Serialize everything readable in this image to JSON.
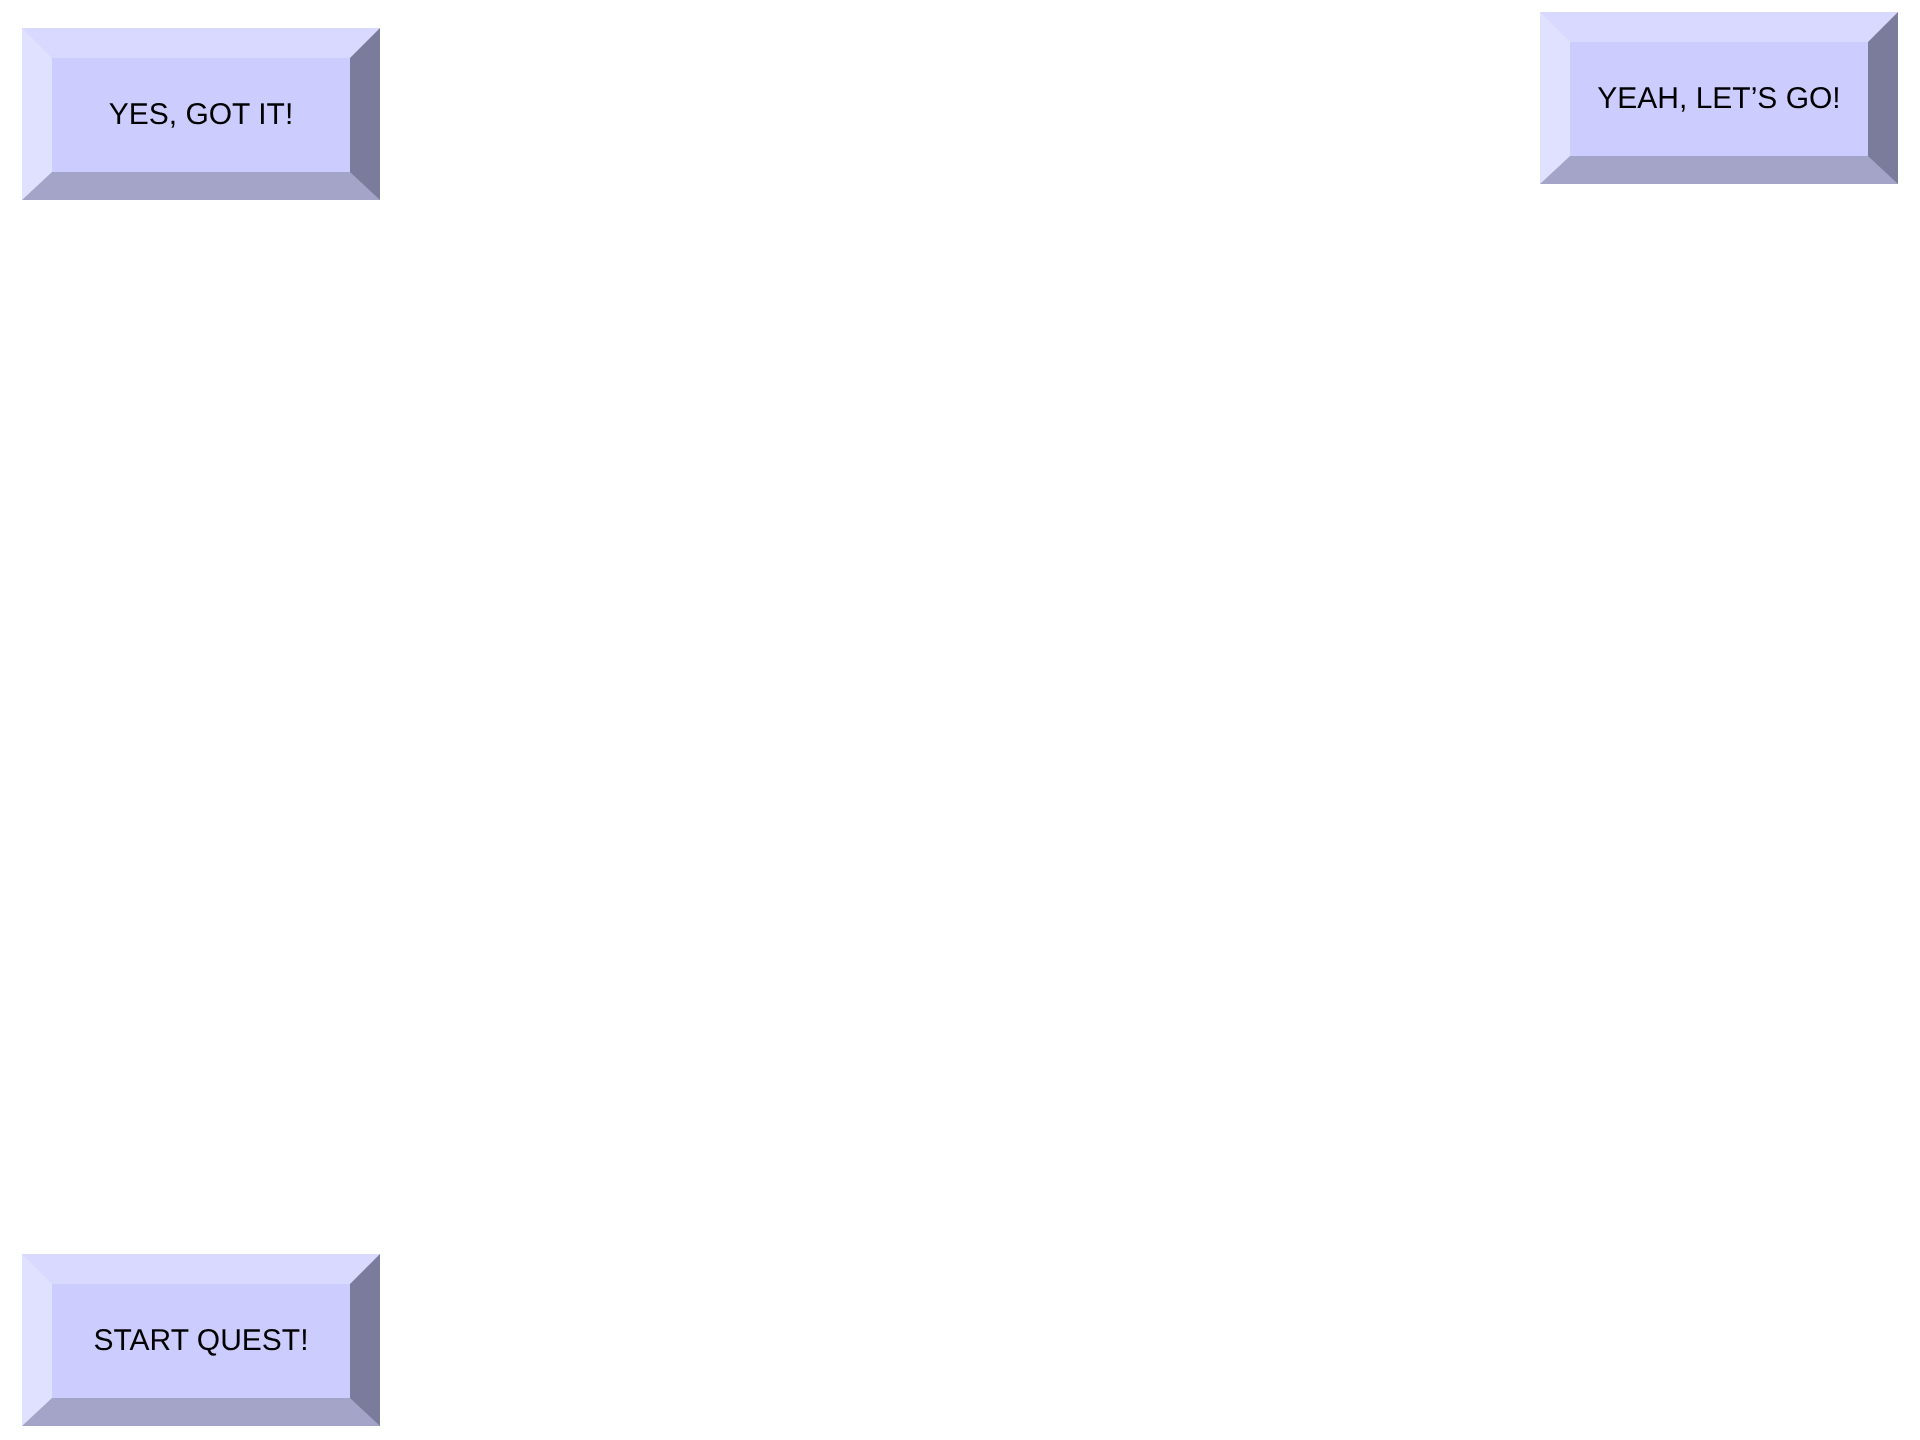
{
  "buttons": [
    {
      "label": "YES, GOT IT!"
    },
    {
      "label": "YEAH, LET’S GO!"
    },
    {
      "label": "START QUEST!"
    }
  ]
}
